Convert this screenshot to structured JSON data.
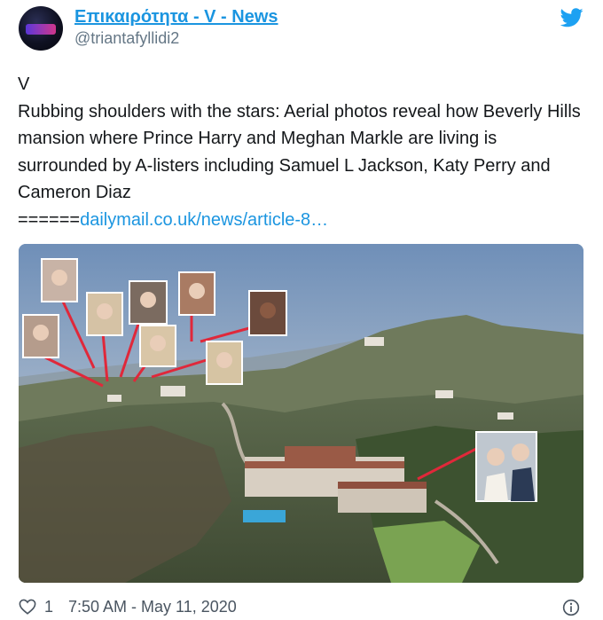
{
  "tweet": {
    "author": {
      "display_name": "Επικαιρότητα - V - News",
      "handle": "@triantafyllidi2",
      "avatar_icon": "avatar-image"
    },
    "text_lines": [
      "V",
      "Rubbing shoulders with the stars: Aerial photos reveal how Beverly Hills mansion where Prince Harry and Meghan Markle are living is surrounded by A-listers including Samuel L Jackson, Katy Perry and Cameron Diaz"
    ],
    "link_prefix": "======",
    "link_text": "dailymail.co.uk/news/article-8…",
    "photo_icon": "aerial-photo",
    "like_count": "1",
    "timestamp": "7:50 AM - May 11, 2020",
    "icons": {
      "brand": "twitter-bird-icon",
      "like": "heart-icon",
      "info": "info-icon"
    },
    "colors": {
      "link": "#1b95e0",
      "text": "#14171a",
      "muted": "#657786",
      "annotation_line": "#e0283a"
    }
  }
}
